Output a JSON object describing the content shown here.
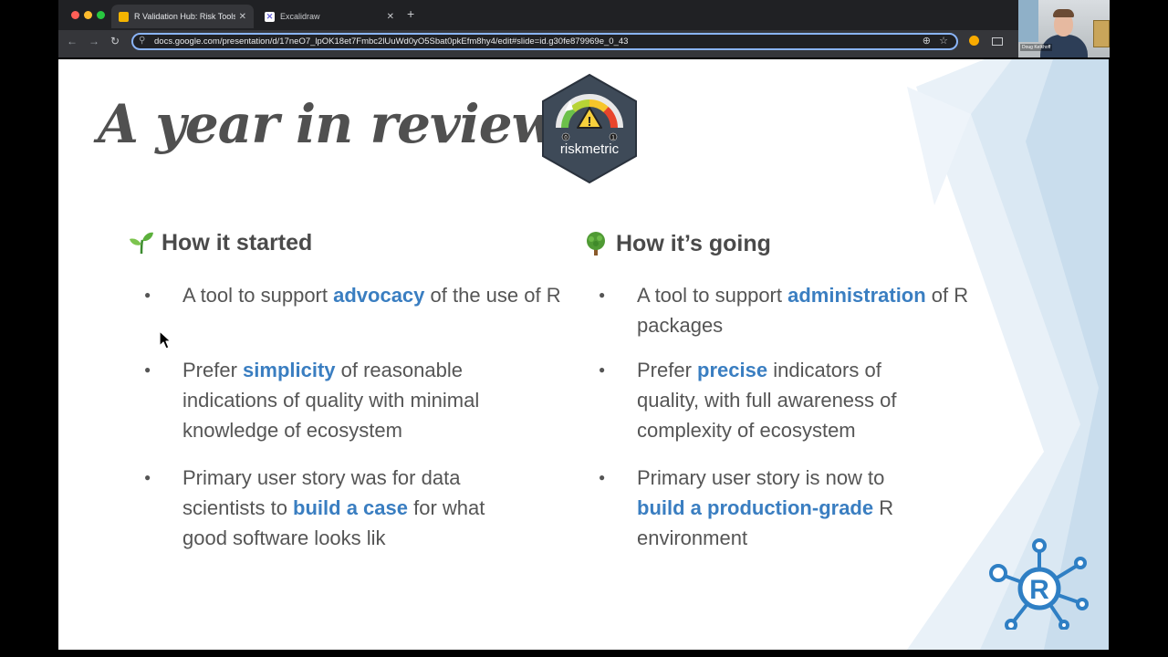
{
  "browser": {
    "tabs": [
      {
        "label": "R Validation Hub: Risk Tools D",
        "active": true
      },
      {
        "label": "Excalidraw",
        "active": false
      }
    ],
    "url": "docs.google.com/presentation/d/17neO7_lpOK18et7Fmbc2lUuWd0yO5Sbat0pkEfm8hy4/edit#slide=id.g30fe879969e_0_43"
  },
  "webcam": {
    "name": "Doug Kelkhoff"
  },
  "slide": {
    "title": "A year in review",
    "logo_label": "riskmetric",
    "logo_ticks": [
      "0",
      "1"
    ],
    "left": {
      "heading": "How it started",
      "bullets": [
        {
          "pre": "A tool to support ",
          "hl": "advocacy",
          "post": " of the use of R"
        },
        {
          "pre": "Prefer ",
          "hl": "simplicity",
          "post": " of reasonable indications of quality with minimal knowledge of ecosystem"
        },
        {
          "pre": "Primary user story was for data scientists to ",
          "hl": "build a case",
          "post": " for what good software looks lik"
        }
      ]
    },
    "right": {
      "heading": "How it’s going",
      "bullets": [
        {
          "pre": "A tool to support ",
          "hl": "administration",
          "post": " of R packages"
        },
        {
          "pre": "Prefer ",
          "hl": "precise",
          "post": " indicators of quality, with full awareness of complexity of ecosystem"
        },
        {
          "pre": "Primary user story is now to ",
          "hl": "build a production-grade",
          "post": " R environment"
        }
      ]
    },
    "r_logo_letter": "R"
  },
  "colors": {
    "accent": "#3a7ec1",
    "hex_bg": "#3e4a58",
    "title": "#505050"
  }
}
